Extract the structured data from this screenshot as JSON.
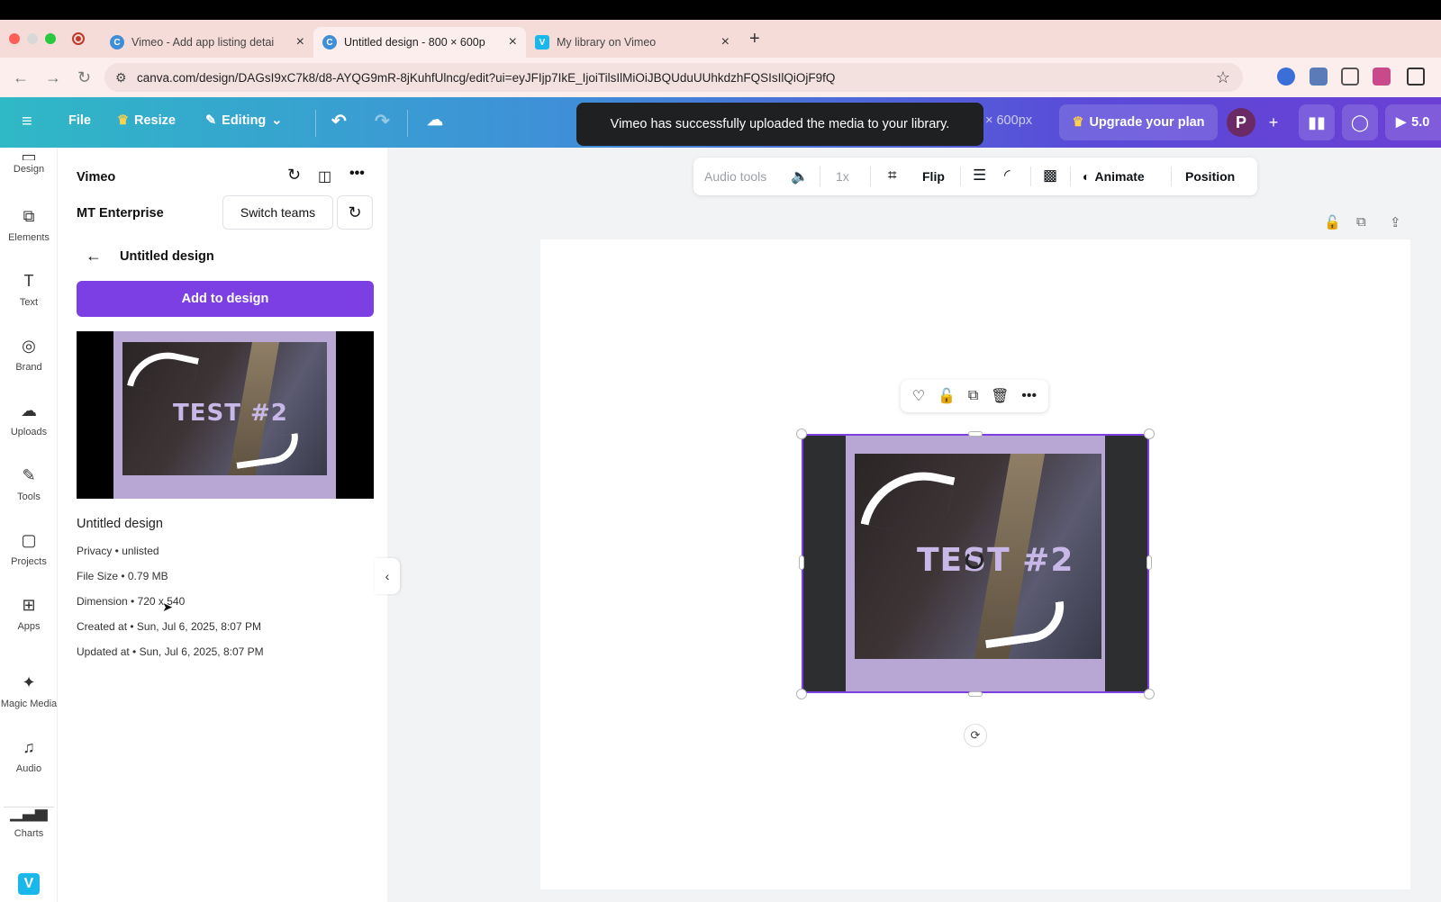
{
  "browser": {
    "tabs": [
      {
        "title": "Vimeo - Add app listing detai",
        "active": false
      },
      {
        "title": "Untitled design - 800 × 600p",
        "active": true
      },
      {
        "title": "My library on Vimeo",
        "active": false
      }
    ],
    "url": "canva.com/design/DAGsI9xC7k8/d8-AYQG9mR-8jKuhfUlncg/edit?ui=eyJFIjp7IkE_IjoiTilsIlMiOiJBQUduUUhkdzhFQSIsIlQiOjF9fQ"
  },
  "header": {
    "file": "File",
    "resize": "Resize",
    "editing": "Editing",
    "size_suffix": "× 600px",
    "upgrade": "Upgrade your plan",
    "avatar_letter": "P",
    "present_label": "5.0"
  },
  "toast": {
    "message": "Vimeo has successfully uploaded the media to your library."
  },
  "rail": [
    {
      "label": "Design",
      "icon": "design-icon"
    },
    {
      "label": "Elements",
      "icon": "elements-icon"
    },
    {
      "label": "Text",
      "icon": "text-icon"
    },
    {
      "label": "Brand",
      "icon": "brand-icon"
    },
    {
      "label": "Uploads",
      "icon": "uploads-icon"
    },
    {
      "label": "Tools",
      "icon": "tools-icon"
    },
    {
      "label": "Projects",
      "icon": "projects-icon"
    },
    {
      "label": "Apps",
      "icon": "apps-icon"
    },
    {
      "label": "Magic Media",
      "icon": "magic-media-icon"
    },
    {
      "label": "Audio",
      "icon": "audio-icon"
    },
    {
      "label": "Charts",
      "icon": "charts-icon"
    }
  ],
  "panel": {
    "app_name": "Vimeo",
    "team": "MT Enterprise",
    "switch_teams": "Switch teams",
    "back_title": "Untitled design",
    "add_to_design": "Add to design",
    "video_title": "Untitled design",
    "thumbnail_text": "TEST #2",
    "meta": [
      "Privacy • unlisted",
      "File Size • 0.79 MB",
      "Dimension • 720 x 540",
      "Created at • Sun, Jul 6, 2025, 8:07 PM",
      "Updated at • Sun, Jul 6, 2025, 8:07 PM"
    ]
  },
  "context_bar": {
    "audio_tools": "Audio tools",
    "speed": "1x",
    "flip": "Flip",
    "animate": "Animate",
    "position": "Position"
  },
  "canvas": {
    "video_text": "TEST #2"
  },
  "colors": {
    "accent": "#7b3fe4",
    "toast_bg": "#1e2022",
    "tabbar": "#f6dcd9"
  }
}
